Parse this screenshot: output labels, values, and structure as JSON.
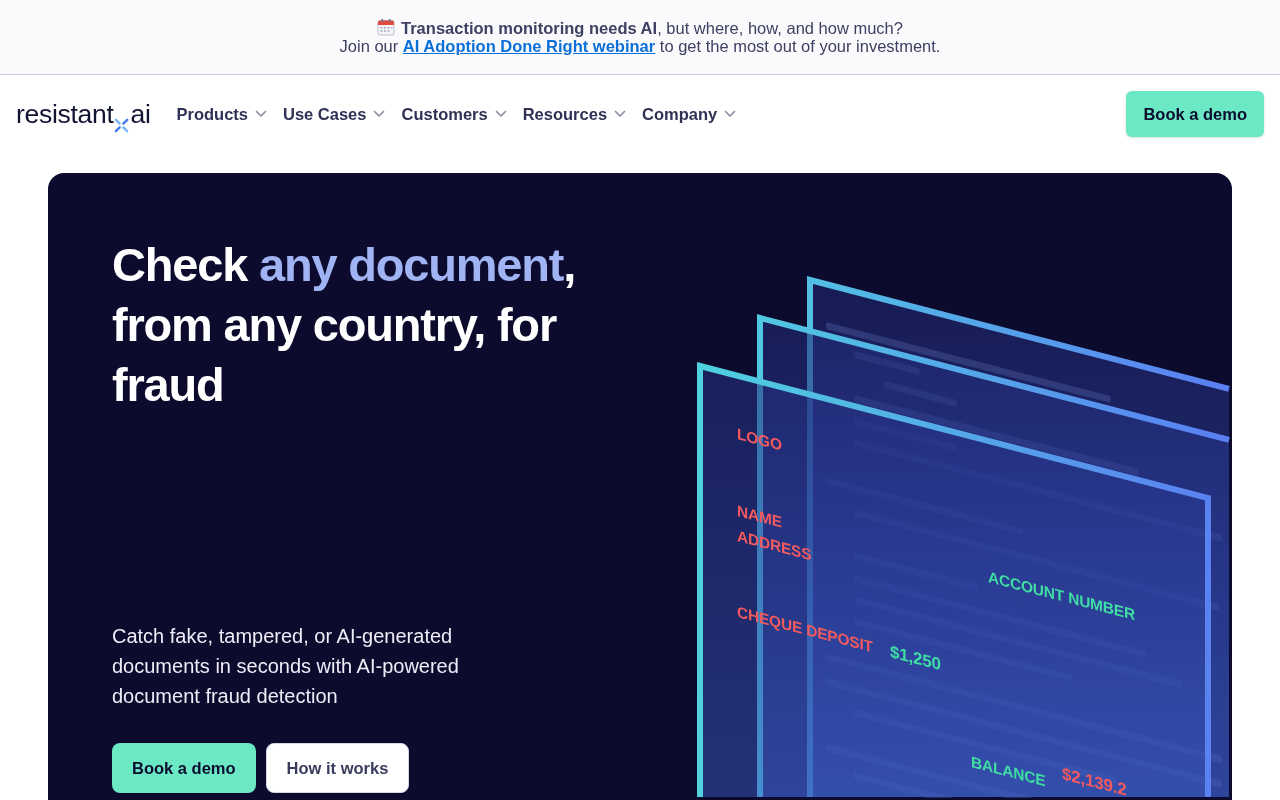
{
  "announcement": {
    "headline": "**Transaction monitoring needs AI**, but where, how, and how much?",
    "line_2": {
      "before": "Join our ",
      "link": "AI Adoption Done Right webinar",
      "after": " to get the most out of your investment."
    }
  },
  "nav": {
    "logo": {
      "text_before": "resistant",
      "text_after": "ai"
    },
    "items": [
      {
        "label": "Products"
      },
      {
        "label": "Use Cases"
      },
      {
        "label": "Customers"
      },
      {
        "label": "Resources"
      },
      {
        "label": "Company"
      }
    ],
    "cta": "Book a demo"
  },
  "hero": {
    "heading": [
      {
        "text": "Check ",
        "highlight": false
      },
      {
        "text": "any document",
        "highlight": true
      },
      {
        "text": ", from any country, for fraud",
        "highlight": false
      }
    ],
    "subtitle": "Catch fake, tampered, or AI-generated documents in seconds with AI-powered document fraud detection",
    "buttons": [
      {
        "label": "Book a demo",
        "kind": "primary"
      },
      {
        "label": "How it works",
        "kind": "secondary"
      }
    ],
    "illustration": {
      "labels": [
        {
          "text": "LOGO",
          "kind": "field",
          "color": "#f25a5e"
        },
        {
          "text": "NAME",
          "kind": "field",
          "color": "#f25a5e"
        },
        {
          "text": "ADDRESS",
          "kind": "field",
          "color": "#f25a5e"
        },
        {
          "text": "ACCOUNT NUMBER",
          "kind": "field",
          "color": "#3fdca4"
        },
        {
          "text": "CHEQUE DEPOSIT",
          "kind": "field",
          "color": "#f25a5e"
        },
        {
          "text": "$1,250",
          "kind": "amount",
          "color": "#3fdca4"
        },
        {
          "text": "BALANCE",
          "kind": "field",
          "color": "#3fdca4"
        },
        {
          "text": "$2,139.2",
          "kind": "amount",
          "color": "#f25a5e"
        }
      ]
    }
  }
}
